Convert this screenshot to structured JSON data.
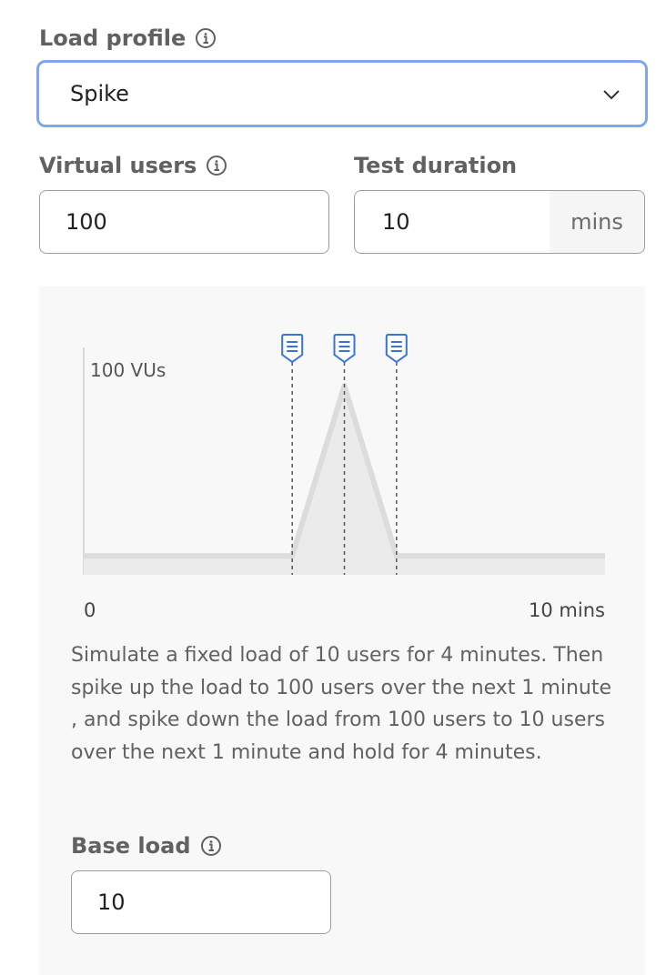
{
  "load_profile": {
    "label": "Load profile",
    "selected": "Spike",
    "info_icon": "info-icon",
    "chevron_icon": "chevron-down-icon"
  },
  "virtual_users": {
    "label": "Virtual users",
    "value": "100",
    "info_icon": "info-icon"
  },
  "test_duration": {
    "label": "Test duration",
    "value": "10",
    "suffix": "mins"
  },
  "chart": {
    "y_label": "100 VUs",
    "x_start_label": "0",
    "x_end_label": "10 mins",
    "marker_icon": "note-marker-icon",
    "accent_color": "#3b73d1",
    "chart_data": {
      "type": "area",
      "x": [
        0,
        4,
        5,
        6,
        10
      ],
      "y": [
        10,
        10,
        100,
        10,
        10
      ],
      "xlim": [
        0,
        10
      ],
      "ylim": [
        0,
        100
      ],
      "markers_at_x": [
        4,
        5,
        6
      ]
    }
  },
  "description": "Simulate a fixed load of 10 users for 4 minutes. Then spike up the load to 100 users over the next 1 minute , and spike down the load from 100 users to 10 users over the next 1 minute and hold for 4 minutes.",
  "base_load": {
    "label": "Base load",
    "value": "10",
    "info_icon": "info-icon"
  }
}
